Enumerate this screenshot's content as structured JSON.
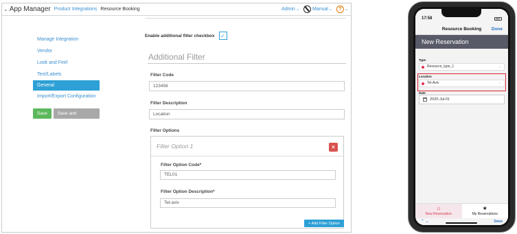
{
  "admin": {
    "app_title": "App Manager",
    "nav": [
      "Product Integrations",
      "Resource Booking"
    ],
    "top_right": {
      "admin": "Admin",
      "manual": "Manual"
    },
    "sidebar": [
      {
        "label": "Manage Integration",
        "active": false
      },
      {
        "label": "Vendor",
        "active": false
      },
      {
        "label": "Look and Feel",
        "active": false
      },
      {
        "label": "Text/Labels",
        "active": false
      },
      {
        "label": "General",
        "active": true
      },
      {
        "label": "Import/Export Configuration",
        "active": false
      }
    ],
    "save_label": "Save",
    "save_continue_label": "Save and Continue Editing",
    "enable_filter_label": "Enable additional filter checkbox",
    "enable_filter_checked": true,
    "section_title": "Additional Filter",
    "filter_code_label": "Filter Code",
    "filter_code_value": "123456",
    "filter_description_label": "Filter Description",
    "filter_description_value": "Location",
    "filter_options_label": "Filter Options",
    "option": {
      "title": "Filter Option 1",
      "code_label": "Filter Option Code*",
      "code_value": "TEL01",
      "description_label": "Filter Option Description*",
      "description_value": "Tel-aviv"
    },
    "add_option_label": "+ Add Filter Option"
  },
  "phone": {
    "time": "17:58",
    "nav_title": "Resource Booking",
    "done_label": "Done",
    "screen_title": "New Reservation",
    "type_label": "Type",
    "type_value": "Resource_type_1",
    "location_label": "Location",
    "location_value": "Tel-Aviv",
    "date_label": "Date",
    "date_value": "2020-Jul-01",
    "tabs": [
      {
        "label": "New Reservation",
        "icon": "home-icon",
        "active": true
      },
      {
        "label": "My Reservations",
        "icon": "star-icon",
        "active": false
      }
    ],
    "bottom_done": "Done"
  }
}
